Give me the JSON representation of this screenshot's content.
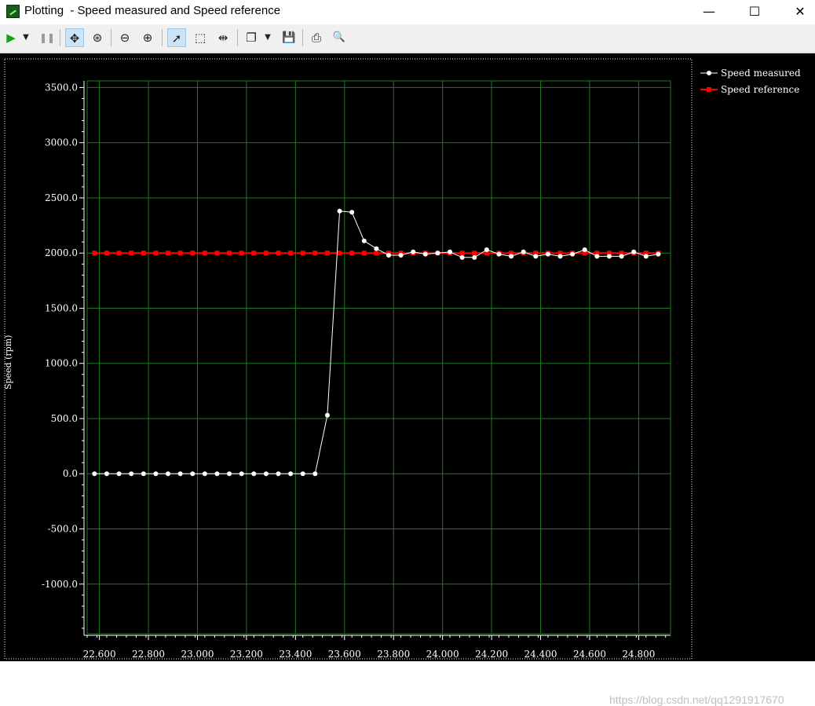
{
  "window": {
    "title": "Plotting  - Speed measured and Speed reference",
    "minimize_glyph": "—",
    "maximize_glyph": "☐",
    "close_glyph": "✕"
  },
  "toolbar": {
    "buttons": [
      {
        "name": "run-icon",
        "glyph": "▶"
      },
      {
        "name": "dropdown-arrow-icon",
        "glyph": "▼"
      },
      {
        "name": "pause-icon",
        "glyph": "❚❚"
      },
      {
        "name": "pan-icon",
        "glyph": "✥"
      },
      {
        "name": "zoom-fit-icon",
        "glyph": "⊛"
      },
      {
        "name": "zoom-out-icon",
        "glyph": "⊖"
      },
      {
        "name": "zoom-in-icon",
        "glyph": "⊕"
      },
      {
        "name": "select-pointer-icon",
        "glyph": "➚"
      },
      {
        "name": "rectangle-select-icon",
        "glyph": "⬚"
      },
      {
        "name": "split-cursor-icon",
        "glyph": "⇹"
      },
      {
        "name": "copy-icon",
        "glyph": "❐"
      },
      {
        "name": "dropdown-arrow-icon",
        "glyph": "▼"
      },
      {
        "name": "save-icon",
        "glyph": "💾"
      },
      {
        "name": "print-icon",
        "glyph": "⎙"
      },
      {
        "name": "print-preview-icon",
        "glyph": "🔍"
      }
    ]
  },
  "colors": {
    "plot_background": "#000000",
    "grid": "#1e7a1e",
    "axis": "#ffffff",
    "speed_measured": "#ffffff",
    "speed_reference": "#ff0000"
  },
  "watermark": "https://blog.csdn.net/qq1291917670",
  "chart_data": {
    "type": "line",
    "title": "",
    "xlabel": "",
    "ylabel": "Speed (rpm)",
    "xlim": [
      22.55,
      24.93
    ],
    "ylim": [
      -1450,
      3560
    ],
    "grid": true,
    "legend_position": "top-right",
    "x_ticks": [
      22.6,
      22.8,
      23.0,
      23.2,
      23.4,
      23.6,
      23.8,
      24.0,
      24.2,
      24.4,
      24.6,
      24.8
    ],
    "x_tick_labels": [
      "22.600",
      "22.800",
      "23.000",
      "23.200",
      "23.400",
      "23.600",
      "23.800",
      "24.000",
      "24.200",
      "24.400",
      "24.600",
      "24.800"
    ],
    "y_ticks": [
      3500,
      3000,
      2500,
      2000,
      1500,
      1000,
      500,
      0,
      -500,
      -1000
    ],
    "y_tick_labels": [
      "3500.0",
      "3000.0",
      "2500.0",
      "2000.0",
      "1500.0",
      "1000.0",
      "500.0",
      "0.0",
      "-500.0",
      "-1000.0"
    ],
    "series": [
      {
        "name": "Speed measured",
        "color": "#ffffff",
        "x": [
          22.58,
          22.63,
          22.68,
          22.73,
          22.78,
          22.83,
          22.88,
          22.93,
          22.98,
          23.03,
          23.08,
          23.13,
          23.18,
          23.23,
          23.28,
          23.33,
          23.38,
          23.43,
          23.48,
          23.53,
          23.58,
          23.63,
          23.68,
          23.73,
          23.78,
          23.83,
          23.88,
          23.93,
          23.98,
          24.03,
          24.08,
          24.13,
          24.18,
          24.23,
          24.28,
          24.33,
          24.38,
          24.43,
          24.48,
          24.53,
          24.58,
          24.63,
          24.68,
          24.73,
          24.78,
          24.83,
          24.88
        ],
        "y": [
          0,
          0,
          0,
          0,
          0,
          0,
          0,
          0,
          0,
          0,
          0,
          0,
          0,
          0,
          0,
          0,
          0,
          0,
          0,
          530,
          2380,
          2370,
          2110,
          2040,
          1980,
          1980,
          2010,
          1990,
          2000,
          2010,
          1960,
          1960,
          2030,
          1990,
          1970,
          2010,
          1970,
          1990,
          1970,
          1990,
          2030,
          1970,
          1970,
          1970,
          2010,
          1970,
          1990
        ]
      },
      {
        "name": "Speed reference",
        "color": "#ff0000",
        "x": [
          22.58,
          22.63,
          22.68,
          22.73,
          22.78,
          22.83,
          22.88,
          22.93,
          22.98,
          23.03,
          23.08,
          23.13,
          23.18,
          23.23,
          23.28,
          23.33,
          23.38,
          23.43,
          23.48,
          23.53,
          23.58,
          23.63,
          23.68,
          23.73,
          23.78,
          23.83,
          23.88,
          23.93,
          23.98,
          24.03,
          24.08,
          24.13,
          24.18,
          24.23,
          24.28,
          24.33,
          24.38,
          24.43,
          24.48,
          24.53,
          24.58,
          24.63,
          24.68,
          24.73,
          24.78,
          24.83,
          24.88
        ],
        "y": [
          2000,
          2000,
          2000,
          2000,
          2000,
          2000,
          2000,
          2000,
          2000,
          2000,
          2000,
          2000,
          2000,
          2000,
          2000,
          2000,
          2000,
          2000,
          2000,
          2000,
          2000,
          2000,
          2000,
          2000,
          2000,
          2000,
          2000,
          2000,
          2000,
          2000,
          2000,
          2000,
          2000,
          2000,
          2000,
          2000,
          2000,
          2000,
          2000,
          2000,
          2000,
          2000,
          2000,
          2000,
          2000,
          2000,
          2000
        ]
      }
    ]
  }
}
